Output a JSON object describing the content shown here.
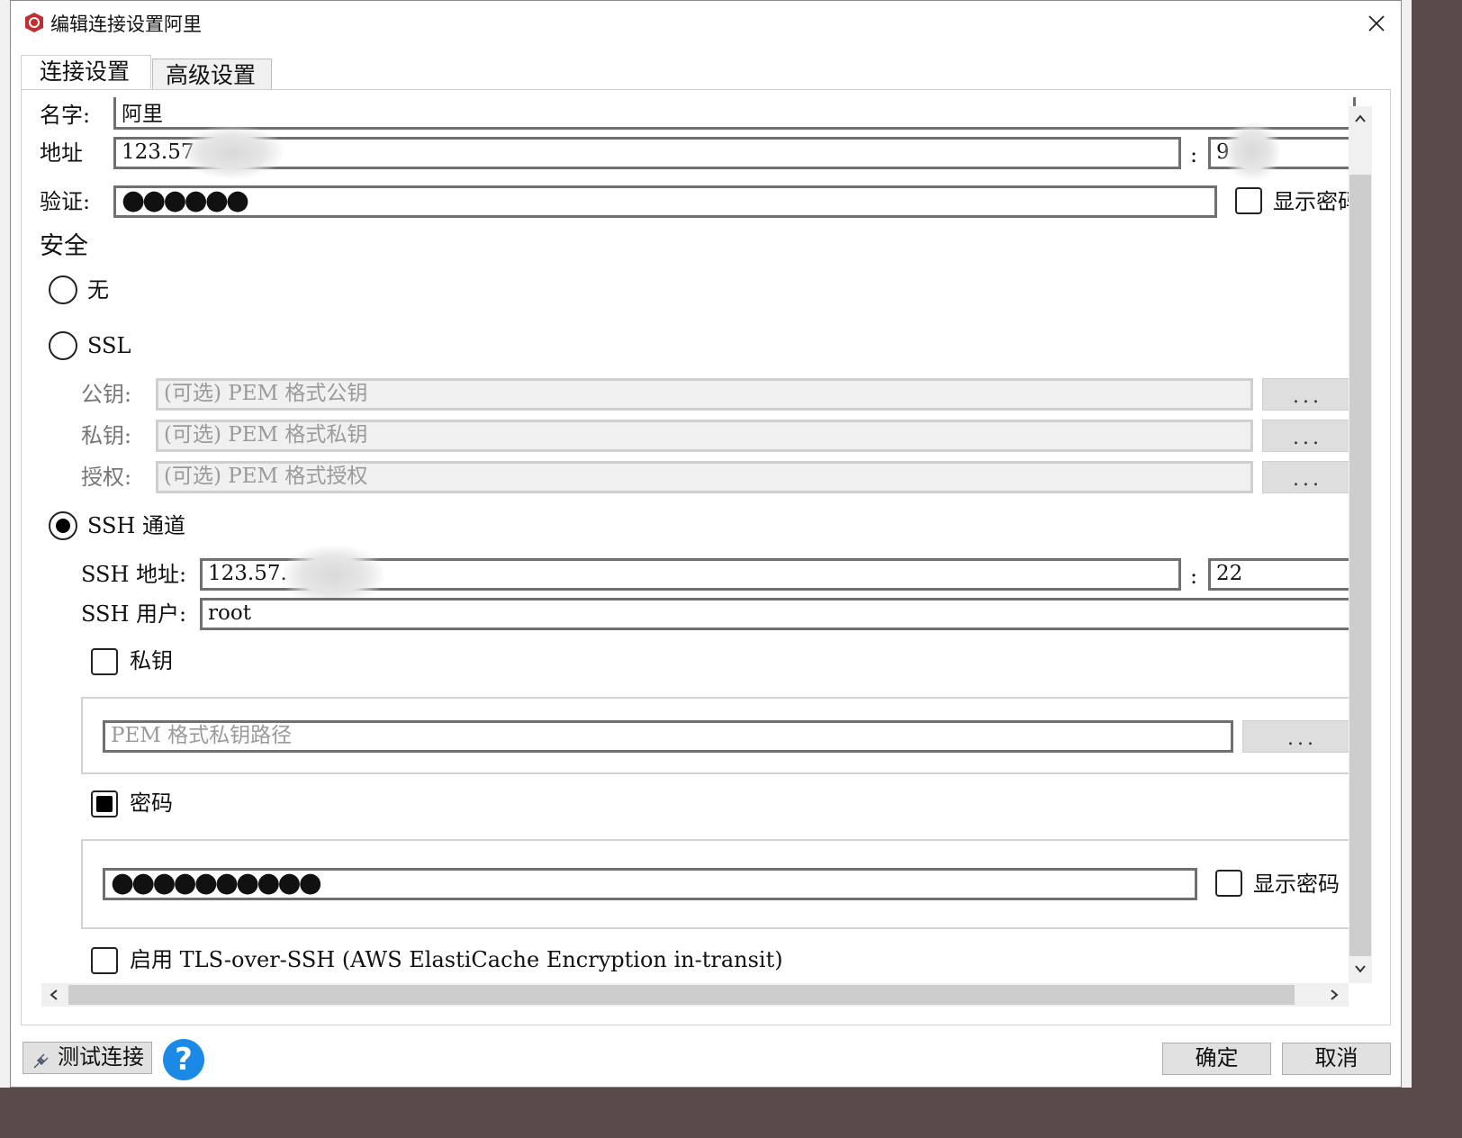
{
  "window": {
    "title": "编辑连接设置阿里"
  },
  "tabs": [
    {
      "label": "连接设置"
    },
    {
      "label": "高级设置"
    }
  ],
  "form": {
    "name_label": "名字:",
    "name_value": "阿里",
    "address_label": "地址",
    "address_value": "123.57",
    "port_sep": ":",
    "port_value": "9",
    "auth_label": "验证:",
    "auth_dots": "●●●●●●",
    "show_password_label": "显示密码"
  },
  "security": {
    "heading": "安全",
    "none_label": "无",
    "ssl_label": "SSL",
    "ssl": {
      "public_key_label": "公钥:",
      "public_key_placeholder": "(可选) PEM 格式公钥",
      "private_key_label": "私钥:",
      "private_key_placeholder": "(可选) PEM 格式私钥",
      "authority_label": "授权:",
      "authority_placeholder": "(可选) PEM 格式授权",
      "browse_label": "..."
    },
    "ssh_label": "SSH 通道",
    "ssh": {
      "address_label": "SSH 地址:",
      "address_value": "123.57.",
      "port_sep": ":",
      "port_value": "22",
      "user_label": "SSH 用户:",
      "user_value": "root",
      "private_key_label": "私钥",
      "private_key_path_placeholder": "PEM 格式私钥路径",
      "browse_label": "...",
      "password_label": "密码",
      "password_dots": "●●●●●●●●●●",
      "show_password_label": "显示密码",
      "tls_label": "启用 TLS-over-SSH (AWS ElastiCache Encryption in-transit)"
    }
  },
  "footer": {
    "test_connection_label": "测试连接",
    "help_symbol": "?",
    "ok_label": "确定",
    "cancel_label": "取消"
  }
}
